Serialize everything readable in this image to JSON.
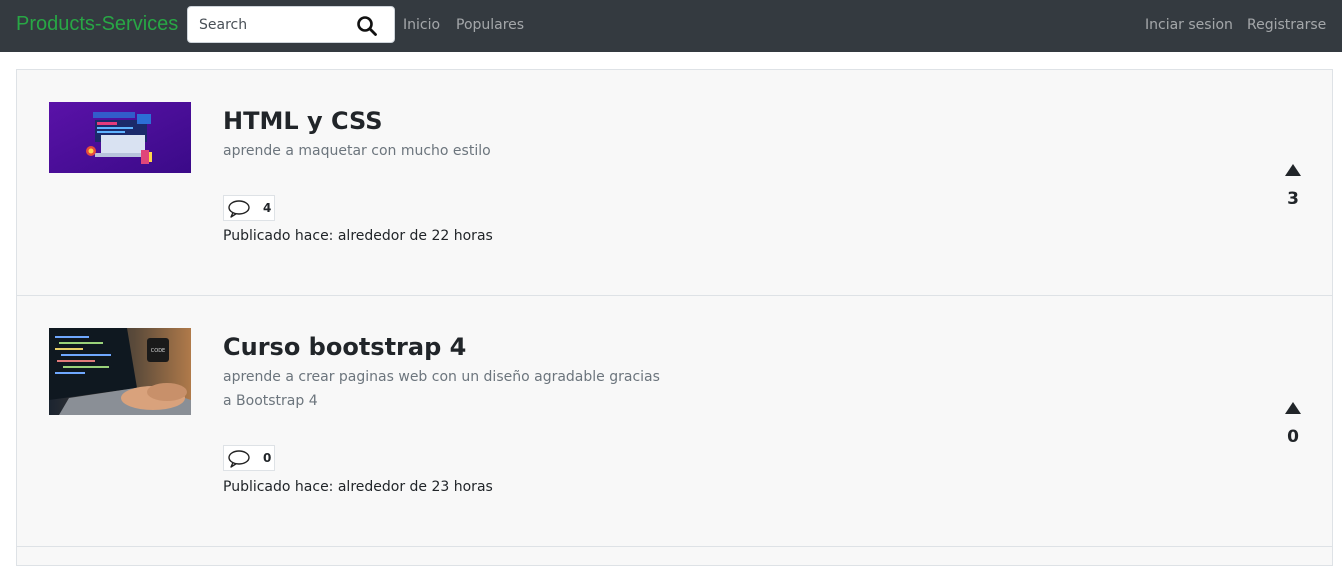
{
  "navbar": {
    "brand": "Products-Services",
    "search_placeholder": "Search",
    "links": [
      "Inicio",
      "Populares"
    ],
    "right_links": [
      "Inciar sesion",
      "Registrarse"
    ],
    "colors": {
      "background": "#343a40",
      "brand": "#28a745"
    }
  },
  "posts": [
    {
      "title": "HTML y CSS",
      "description": "aprende a maquetar con mucho estilo",
      "comments": "4",
      "published": "Publicado hace: alrededor de 22 horas",
      "votes": "3",
      "thumbnail": "laptop-illustration"
    },
    {
      "title": "Curso bootstrap 4",
      "description": "aprende a crear paginas web con un diseño agradable gracias a Bootstrap 4",
      "comments": "0",
      "published": "Publicado hace: alrededor de 23 horas",
      "votes": "0",
      "thumbnail": "laptop-photo"
    }
  ]
}
